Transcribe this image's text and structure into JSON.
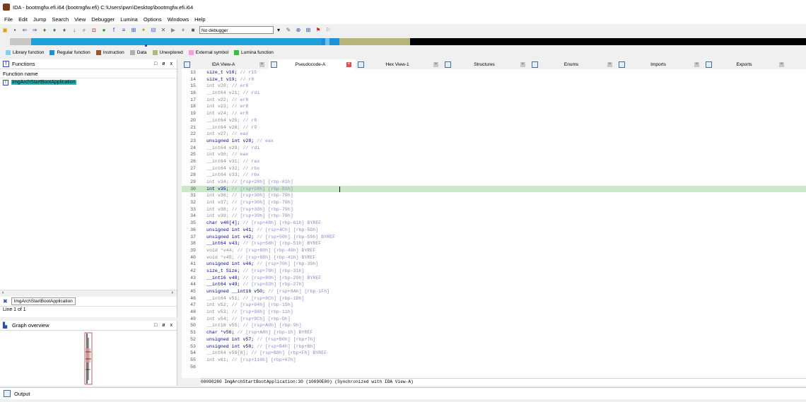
{
  "window": {
    "title": "IDA - bootmgfw.efi.i64 (bootmgfw.efi) C:\\Users\\pwn\\Desktop\\bootmgfw.efi.i64"
  },
  "menu": [
    "File",
    "Edit",
    "Jump",
    "Search",
    "View",
    "Debugger",
    "Lumina",
    "Options",
    "Windows",
    "Help"
  ],
  "toolbar": {
    "debugger_select": "No debugger"
  },
  "legend": [
    {
      "label": "Library function",
      "color": "#7fd3f0"
    },
    {
      "label": "Regular function",
      "color": "#1e90d8"
    },
    {
      "label": "Instruction",
      "color": "#a0522d"
    },
    {
      "label": "Data",
      "color": "#b0b0b0"
    },
    {
      "label": "Unexplored",
      "color": "#b5b57a"
    },
    {
      "label": "External symbol",
      "color": "#ff9ae0"
    },
    {
      "label": "Lumina function",
      "color": "#38c038"
    }
  ],
  "functions_panel": {
    "title": "Functions",
    "column_header": "Function name",
    "items": [
      "ImgArchStartBootApplication"
    ],
    "filter_value": "ImgArchStartBootApplication",
    "status": "Line 1 of 1",
    "controls": [
      "□",
      "ø",
      "x"
    ]
  },
  "graph_panel": {
    "title": "Graph overview",
    "controls": [
      "□",
      "ø",
      "x"
    ]
  },
  "tabs": [
    {
      "label": "IDA View-A",
      "active": false
    },
    {
      "label": "Pseudocode-A",
      "active": true
    },
    {
      "label": "Hex View-1",
      "active": false
    },
    {
      "label": "Structures",
      "active": false
    },
    {
      "label": "Enums",
      "active": false
    },
    {
      "label": "Imports",
      "active": false
    },
    {
      "label": "Exports",
      "active": false
    }
  ],
  "code_lines": [
    {
      "n": "13",
      "decl": "size_t v18;",
      "cm": "// r15",
      "hl": false
    },
    {
      "n": "14",
      "decl": "size_t v19;",
      "cm": "// r8",
      "hl": false
    },
    {
      "n": "15",
      "decl": "int v20;",
      "cm": "// er8",
      "hl": false
    },
    {
      "n": "16",
      "decl": "__int64 v21;",
      "cm": "// rdi",
      "hl": false
    },
    {
      "n": "17",
      "decl": "int v22;",
      "cm": "// er8",
      "hl": false
    },
    {
      "n": "18",
      "decl": "int v23;",
      "cm": "// er8",
      "hl": false
    },
    {
      "n": "19",
      "decl": "int v24;",
      "cm": "// er8",
      "hl": false
    },
    {
      "n": "20",
      "decl": "__int64 v25;",
      "cm": "// r8",
      "hl": false
    },
    {
      "n": "21",
      "decl": "__int64 v26;",
      "cm": "// r9",
      "hl": false
    },
    {
      "n": "22",
      "decl": "int v27;",
      "cm": "// eax",
      "hl": false
    },
    {
      "n": "23",
      "decl": "unsigned int v28;",
      "cm": "// eax",
      "hl": false
    },
    {
      "n": "24",
      "decl": "__int64 v29;",
      "cm": "// rdi",
      "hl": false
    },
    {
      "n": "25",
      "decl": "int v30;",
      "cm": "// eax",
      "hl": false
    },
    {
      "n": "26",
      "decl": "__int64 v31;",
      "cm": "// rax",
      "hl": false
    },
    {
      "n": "27",
      "decl": "__int64 v32;",
      "cm": "// rbx",
      "hl": false
    },
    {
      "n": "28",
      "decl": "__int64 v33;",
      "cm": "// rbx",
      "hl": false
    },
    {
      "n": "29",
      "decl": "int v34;",
      "cm": "// [rsp+28h] [rbp-81h]",
      "hl": false
    },
    {
      "n": "30",
      "decl": "int v35;",
      "cm": "// [rsp+28h] [rbp-81h]",
      "hl": true
    },
    {
      "n": "31",
      "decl": "int v36;",
      "cm": "// [rsp+30h] [rbp-79h]",
      "hl": false
    },
    {
      "n": "32",
      "decl": "int v37;",
      "cm": "// [rsp+30h] [rbp-79h]",
      "hl": false
    },
    {
      "n": "33",
      "decl": "int v38;",
      "cm": "// [rsp+30h] [rbp-79h]",
      "hl": false
    },
    {
      "n": "34",
      "decl": "int v39;",
      "cm": "// [rsp+30h] [rbp-79h]",
      "hl": false
    },
    {
      "n": "35",
      "decl": "char v40[4];",
      "cm": "// [rsp+48h] [rbp-61h] BYREF",
      "hl": false
    },
    {
      "n": "36",
      "decl": "unsigned int v41;",
      "cm": "// [rsp+4Ch] [rbp-5Dh]",
      "hl": false
    },
    {
      "n": "37",
      "decl": "unsigned int v42;",
      "cm": "// [rsp+50h] [rbp-59h] BYREF",
      "hl": false
    },
    {
      "n": "38",
      "decl": "__int64 v43;",
      "cm": "// [rsp+58h] [rbp-51h] BYREF",
      "hl": false
    },
    {
      "n": "39",
      "decl": "void *v44;",
      "cm": "// [rsp+60h] [rbp-49h] BYREF",
      "hl": false
    },
    {
      "n": "40",
      "decl": "void *v45;",
      "cm": "// [rsp+68h] [rbp-41h] BYREF",
      "hl": false
    },
    {
      "n": "41",
      "decl": "unsigned int v46;",
      "cm": "// [rsp+70h] [rbp-39h]",
      "hl": false
    },
    {
      "n": "42",
      "decl": "size_t Size;",
      "cm": "// [rsp+78h] [rbp-31h]",
      "hl": false
    },
    {
      "n": "43",
      "decl": "__int16 v48;",
      "cm": "// [rsp+80h] [rbp-29h] BYREF",
      "hl": false
    },
    {
      "n": "44",
      "decl": "__int64 v49;",
      "cm": "// [rsp+82h] [rbp-27h]",
      "hl": false
    },
    {
      "n": "45",
      "decl": "unsigned __int16 v50;",
      "cm": "// [rsp+8Ah] [rbp-1Fh]",
      "hl": false
    },
    {
      "n": "46",
      "decl": "__int64 v51;",
      "cm": "// [rsp+8Ch] [rbp-1Dh]",
      "hl": false
    },
    {
      "n": "47",
      "decl": "int v52;",
      "cm": "// [rsp+94h] [rbp-15h]",
      "hl": false
    },
    {
      "n": "48",
      "decl": "int v53;",
      "cm": "// [rsp+98h] [rbp-11h]",
      "hl": false
    },
    {
      "n": "49",
      "decl": "int v54;",
      "cm": "// [rsp+9Ch] [rbp-Dh]",
      "hl": false
    },
    {
      "n": "50",
      "decl": "__int16 v55;",
      "cm": "// [rsp+A0h] [rbp-9h]",
      "hl": false
    },
    {
      "n": "51",
      "decl": "char *v56;",
      "cm": "// [rsp+A8h] [rbp-1h] BYREF",
      "hl": false
    },
    {
      "n": "52",
      "decl": "unsigned int v57;",
      "cm": "// [rsp+B0h] [rbp+7h]",
      "hl": false
    },
    {
      "n": "53",
      "decl": "unsigned int v58;",
      "cm": "// [rsp+B4h] [rbp+Bh]",
      "hl": false
    },
    {
      "n": "54",
      "decl": "__int64 v59[8];",
      "cm": "// [rsp+B8h] [rbp+Fh] BYREF",
      "hl": false
    },
    {
      "n": "55",
      "decl": "int v61;",
      "cm": "// [rsp+110h] [rbp+67h]",
      "hl": false
    },
    {
      "n": "56",
      "decl": "",
      "cm": "",
      "hl": false
    }
  ],
  "status_line": "00090280 ImgArchStartBootApplication:30 (10090E80) (Synchronized with IDA View-A)",
  "output_label": "Output"
}
